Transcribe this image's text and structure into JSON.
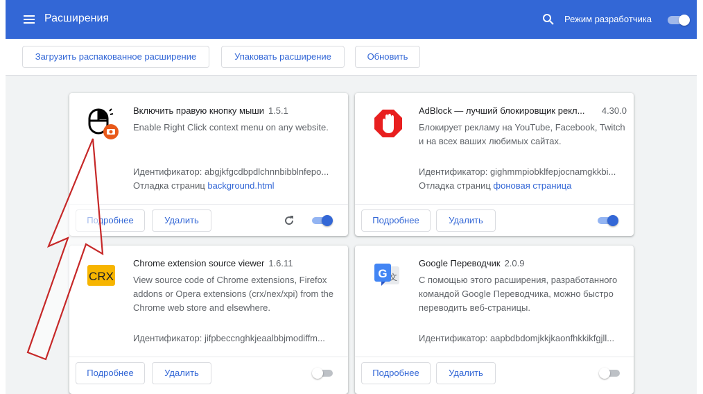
{
  "header": {
    "title": "Расширения",
    "dev_mode_label": "Режим разработчика",
    "dev_mode_on": true,
    "accent_color": "#3367d6"
  },
  "toolbar": {
    "load_unpacked": "Загрузить распакованное расширение",
    "pack": "Упаковать расширение",
    "update": "Обновить"
  },
  "extensions": [
    {
      "name": "Включить правую кнопку мыши",
      "version": "1.5.1",
      "description": "Enable Right Click context menu on any website.",
      "id_label": "Идентификатор:",
      "id_value": "abgjkfgcdbpdlchnnbibblnfepo...",
      "inspect_label": "Отладка страниц",
      "inspect_link": "background.html",
      "details_label": "Подробнее",
      "remove_label": "Удалить",
      "enabled": true,
      "icon": "mouse-icon"
    },
    {
      "name": "AdBlock — лучший блокировщик рекл...",
      "version": "4.30.0",
      "description": "Блокирует рекламу на YouTube, Facebook, Twitch и на всех ваших любимых сайтах.",
      "id_label": "Идентификатор:",
      "id_value": "gighmmpiobklfepjocnamgkkbi...",
      "inspect_label": "Отладка страниц",
      "inspect_link": "фоновая страница",
      "details_label": "Подробнее",
      "remove_label": "Удалить",
      "enabled": true,
      "icon": "adblock-hand-icon"
    },
    {
      "name": "Chrome extension source viewer",
      "version": "1.6.11",
      "description": "View source code of Chrome extensions, Firefox addons or Opera extensions (crx/nex/xpi) from the Chrome web store and elsewhere.",
      "id_label": "Идентификатор:",
      "id_value": "jifpbeccnghkjeaalbbjmodiffm...",
      "details_label": "Подробнее",
      "remove_label": "Удалить",
      "enabled": false,
      "icon": "crx-icon",
      "icon_text": "CRX"
    },
    {
      "name": "Google Переводчик",
      "version": "2.0.9",
      "description": "С помощью этого расширения, разработанного командой Google Переводчика, можно быстро переводить веб-страницы.",
      "id_label": "Идентификатор:",
      "id_value": "aapbdbdomjkkjkaonfhkkikfgjll...",
      "details_label": "Подробнее",
      "remove_label": "Удалить",
      "enabled": false,
      "icon": "google-translate-icon",
      "icon_text": "G"
    }
  ],
  "annotation": {
    "arrow_color": "#c62828"
  }
}
